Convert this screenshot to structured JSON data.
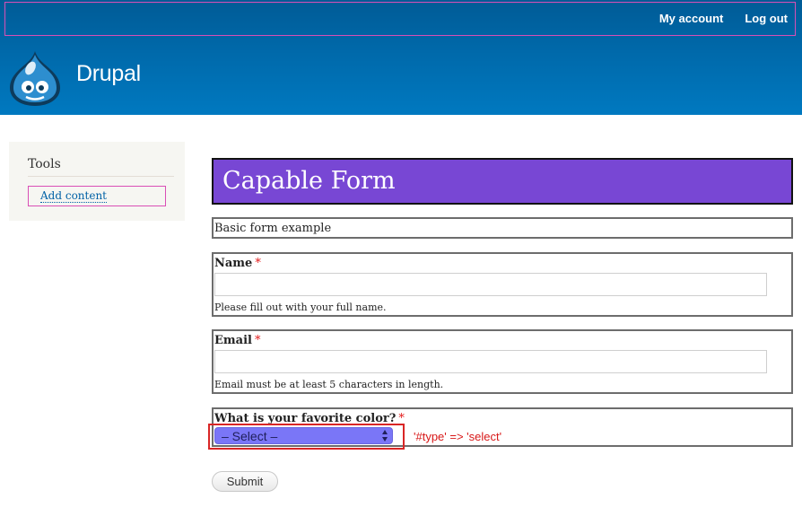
{
  "header": {
    "site_name": "Drupal",
    "secondary_menu": [
      "My account",
      "Log out"
    ]
  },
  "sidebar": {
    "title": "Tools",
    "link": "Add content"
  },
  "form": {
    "title": "Capable Form",
    "description": "Basic form example",
    "name": {
      "label": "Name",
      "required_mark": "*",
      "value": "",
      "help": "Please fill out with your full name."
    },
    "email": {
      "label": "Email",
      "required_mark": "*",
      "value": "",
      "help": "Email must be at least 5 characters in length."
    },
    "color": {
      "label": "What is your favorite color?",
      "required_mark": "*",
      "selected": "– Select –"
    },
    "annotation": "'#type' => 'select'",
    "submit_label": "Submit"
  },
  "colors": {
    "header_blue": "#0069aa",
    "title_purple": "#7847d4",
    "select_purple": "#7a76f7",
    "required_red": "#e21b1b",
    "highlight_pink": "#d94fb6",
    "annotation_red": "#d81818"
  },
  "icons": {
    "logo": "drupal-drop-icon",
    "select_arrows": "select-updown-icon"
  }
}
